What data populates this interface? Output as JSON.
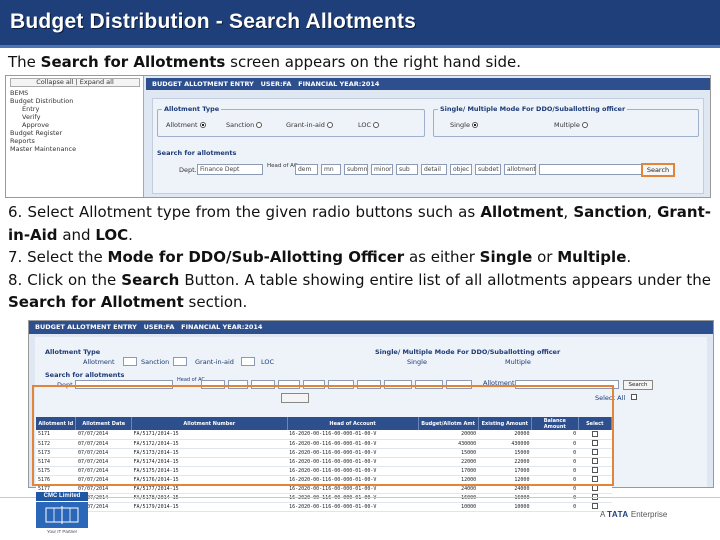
{
  "slide": {
    "title": "Budget Distribution - Search Allotments",
    "intro": {
      "pre": "The ",
      "bold": "Search for Allotments",
      "post": " screen appears on the right hand side."
    },
    "steps": [
      {
        "parts": [
          {
            "t": "6. Select Allotment type from the given radio buttons such as "
          },
          {
            "t": "Allotment",
            "b": true
          },
          {
            "t": ", "
          },
          {
            "t": "Sanction",
            "b": true
          },
          {
            "t": ", "
          },
          {
            "t": "Grant-in-Aid",
            "b": true
          },
          {
            "t": " and "
          },
          {
            "t": "LOC",
            "b": true
          },
          {
            "t": "."
          }
        ]
      },
      {
        "parts": [
          {
            "t": "7. Select the "
          },
          {
            "t": "Mode for DDO/Sub-Allotting Officer",
            "b": true
          },
          {
            "t": " as either "
          },
          {
            "t": "Single",
            "b": true
          },
          {
            "t": " or "
          },
          {
            "t": "Multiple",
            "b": true
          },
          {
            "t": "."
          }
        ]
      },
      {
        "parts": [
          {
            "t": "8. Click on the "
          },
          {
            "t": "Search",
            "b": true
          },
          {
            "t": " Button. A table showing entire list of all allotments appears under the "
          },
          {
            "t": "Search for Allotment",
            "b": true
          },
          {
            "t": " section."
          }
        ]
      }
    ]
  },
  "screen1": {
    "tree_toggle": "Collapse all | Expand all",
    "tree_items": [
      "BEMS",
      "Budget Distribution",
      "Entry",
      "Verify",
      "Approve",
      "Budget Register",
      "Reports",
      "Master Maintenance"
    ],
    "header": "BUDGET ALLOTMENT ENTRY   USER:FA   FINANCIAL YEAR:2014",
    "allotment_type_legend": "Allotment Type",
    "allotment_options": [
      "Allotment",
      "Sanction",
      "Grant-in-aid",
      "LOC"
    ],
    "mode_legend": "Single/ Multiple Mode For DDO/Suballotting officer",
    "mode_options": [
      "Single",
      "Multiple"
    ],
    "search_legend": "Search for allotments",
    "dept_label": "Dept.",
    "dept_value": "Finance Dept",
    "head_label": "Head of AC",
    "head_fields": [
      "dem",
      "mn",
      "submn",
      "minor",
      "sub",
      "detail",
      "objec",
      "subdet",
      "allotment"
    ],
    "allotment_no_label": "AllotmentNo",
    "search_button": "Search"
  },
  "screen2": {
    "header": "BUDGET ALLOTMENT ENTRY   USER:FA   FINANCIAL YEAR:2014",
    "allotment_type_legend": "Allotment Type",
    "options": [
      "Allotment",
      "Sanction",
      "Grant-in-aid",
      "LOC"
    ],
    "mode_legend": "Single/ Multiple Mode For DDO/Suballotting officer",
    "mode_options": [
      "Single",
      "Multiple"
    ],
    "search_legend": "Search for allotments",
    "dept_label": "Dept.",
    "head_label": "Head of AC",
    "allotment_label": "Allotment No",
    "search_button": "Search",
    "select_all": "Select All",
    "columns": [
      "Allotment Id",
      "Allotment Date",
      "Allotment Number",
      "Head of Account",
      "Budget/Allotm Amt",
      "Existing Amount",
      "Balance Amount",
      "Select"
    ],
    "rows": [
      [
        "5171",
        "07/07/2014",
        "FA/5171/2014-15",
        "16-2020-00-116-00-000-01-00-V",
        "20000",
        "20000",
        "0"
      ],
      [
        "5172",
        "07/07/2014",
        "FA/5172/2014-15",
        "16-2020-00-116-00-000-01-00-V",
        "430000",
        "430000",
        "0"
      ],
      [
        "5173",
        "07/07/2014",
        "FA/5173/2014-15",
        "16-2020-00-116-00-000-01-00-V",
        "15000",
        "15000",
        "0"
      ],
      [
        "5174",
        "07/07/2014",
        "FA/5174/2014-15",
        "16-2020-00-116-00-000-01-00-V",
        "22000",
        "22000",
        "0"
      ],
      [
        "5175",
        "07/07/2014",
        "FA/5175/2014-15",
        "16-2020-00-116-00-000-01-00-V",
        "17000",
        "17000",
        "0"
      ],
      [
        "5176",
        "07/07/2014",
        "FA/5176/2014-15",
        "16-2020-00-116-00-000-01-00-V",
        "12000",
        "12000",
        "0"
      ],
      [
        "5177",
        "07/07/2014",
        "FA/5177/2014-15",
        "16-2020-00-116-00-000-01-00-V",
        "24000",
        "24000",
        "0"
      ],
      [
        "5178",
        "07/07/2014",
        "FA/5178/2014-15",
        "16-2020-00-116-00-000-01-00-V",
        "16000",
        "16000",
        "0"
      ],
      [
        "5179",
        "07/07/2014",
        "FA/5179/2014-15",
        "16-2020-00-116-00-000-01-00-V",
        "10000",
        "10000",
        "0"
      ]
    ]
  },
  "footer": {
    "cmc_name": "CMC Limited",
    "cmc_tagline": "Your IT Partner",
    "tata_pre": "A ",
    "tata_brand": "TATA",
    "tata_post": " Enterprise"
  },
  "colors": {
    "title_bg": "#1f3f7a",
    "header_bg": "#2e4f8e",
    "highlight": "#e3843b"
  }
}
